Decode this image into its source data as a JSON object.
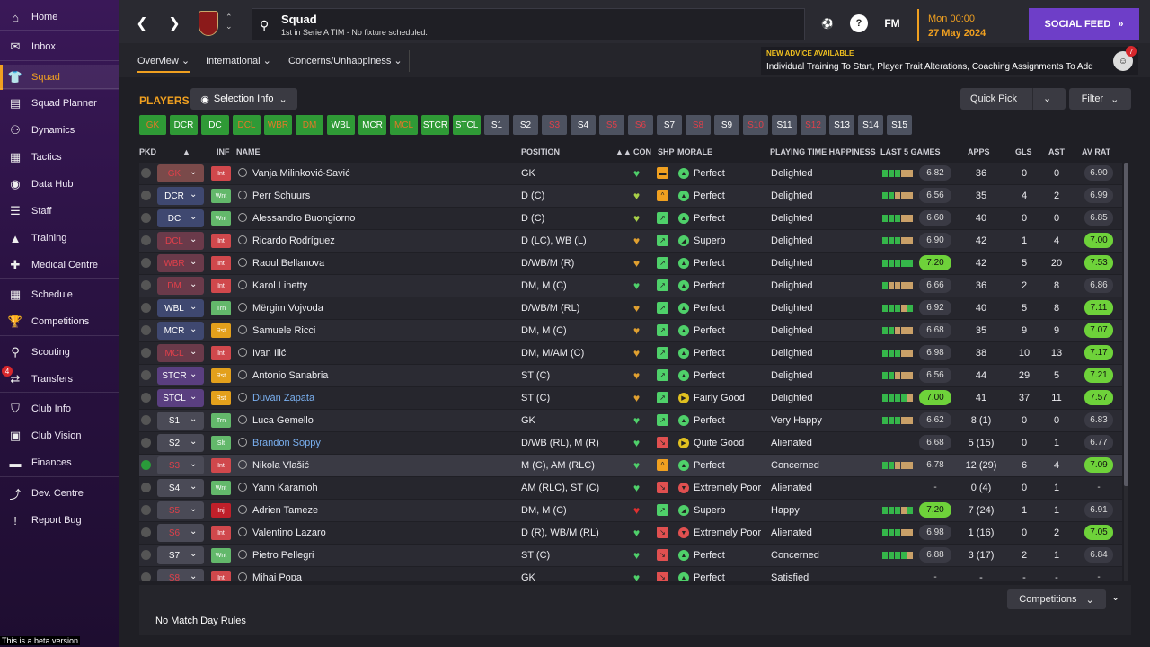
{
  "sidebar": {
    "items": [
      {
        "label": "Home",
        "icon": "⌂",
        "name": "home"
      },
      {
        "label": "Inbox",
        "icon": "✉",
        "name": "inbox"
      },
      {
        "label": "Squad",
        "icon": "👕",
        "name": "squad"
      },
      {
        "label": "Squad Planner",
        "icon": "▤",
        "name": "squad-planner"
      },
      {
        "label": "Dynamics",
        "icon": "⚇",
        "name": "dynamics"
      },
      {
        "label": "Tactics",
        "icon": "▦",
        "name": "tactics"
      },
      {
        "label": "Data Hub",
        "icon": "◉",
        "name": "data-hub"
      },
      {
        "label": "Staff",
        "icon": "☰",
        "name": "staff"
      },
      {
        "label": "Training",
        "icon": "▲",
        "name": "training"
      },
      {
        "label": "Medical Centre",
        "icon": "✚",
        "name": "medical-centre"
      },
      {
        "label": "Schedule",
        "icon": "▦",
        "name": "schedule"
      },
      {
        "label": "Competitions",
        "icon": "🏆",
        "name": "competitions"
      },
      {
        "label": "Scouting",
        "icon": "⚲",
        "name": "scouting"
      },
      {
        "label": "Transfers",
        "icon": "⇄",
        "name": "transfers"
      },
      {
        "label": "Club Info",
        "icon": "⛉",
        "name": "club-info"
      },
      {
        "label": "Club Vision",
        "icon": "▣",
        "name": "club-vision"
      },
      {
        "label": "Finances",
        "icon": "▬",
        "name": "finances"
      },
      {
        "label": "Dev. Centre",
        "icon": "⤴",
        "name": "dev-centre"
      },
      {
        "label": "Report Bug",
        "icon": "!",
        "name": "report-bug"
      }
    ],
    "transfers_badge": "4",
    "beta_notice": "This is a beta version"
  },
  "topbar": {
    "title": "Squad",
    "subtitle": "1st in Serie A TIM - No fixture scheduled.",
    "fm_label": "FM",
    "help_label": "?",
    "date_line1": "Mon 00:00",
    "date_line2": "27 May 2024",
    "social_feed": "SOCIAL FEED"
  },
  "subtabs": {
    "overview": "Overview",
    "international": "International",
    "concerns": "Concerns/Unhappiness"
  },
  "advice": {
    "heading": "NEW ADVICE AVAILABLE",
    "text": "Individual Training To Start, Player Trait Alterations, Coaching Assignments To Add",
    "count": "7"
  },
  "main": {
    "players_title": "PLAYERS",
    "selection_info": "Selection Info",
    "quick_pick": "Quick Pick",
    "filter": "Filter"
  },
  "slots": [
    {
      "label": "GK",
      "style": "gr"
    },
    {
      "label": "DCR",
      "style": "g"
    },
    {
      "label": "DC",
      "style": "g"
    },
    {
      "label": "DCL",
      "style": "gr"
    },
    {
      "label": "WBR",
      "style": "gr"
    },
    {
      "label": "DM",
      "style": "gr"
    },
    {
      "label": "WBL",
      "style": "g"
    },
    {
      "label": "MCR",
      "style": "g"
    },
    {
      "label": "MCL",
      "style": "gr"
    },
    {
      "label": "STCR",
      "style": "g"
    },
    {
      "label": "STCL",
      "style": "g"
    },
    {
      "label": "S1",
      "style": "s"
    },
    {
      "label": "S2",
      "style": "s"
    },
    {
      "label": "S3",
      "style": "sr"
    },
    {
      "label": "S4",
      "style": "s"
    },
    {
      "label": "S5",
      "style": "sr"
    },
    {
      "label": "S6",
      "style": "sr"
    },
    {
      "label": "S7",
      "style": "s"
    },
    {
      "label": "S8",
      "style": "sr"
    },
    {
      "label": "S9",
      "style": "s"
    },
    {
      "label": "S10",
      "style": "sr"
    },
    {
      "label": "S11",
      "style": "s"
    },
    {
      "label": "S12",
      "style": "sr"
    },
    {
      "label": "S13",
      "style": "s"
    },
    {
      "label": "S14",
      "style": "s"
    },
    {
      "label": "S15",
      "style": "s"
    }
  ],
  "columns": {
    "pkd": "PKD",
    "inf": "INF",
    "name": "NAME",
    "position": "POSITION",
    "con": "CON",
    "shp": "SHP",
    "morale": "MORALE",
    "pth": "PLAYING TIME HAPPINESS",
    "last5": "LAST 5 GAMES",
    "apps": "APPS",
    "gls": "GLS",
    "ast": "AST",
    "avrat": "AV RAT"
  },
  "colors": {
    "accent": "#f0a020",
    "social": "#6e3ec8",
    "good": "#6ed23a"
  },
  "players": [
    {
      "slot": "GK",
      "slot_red": true,
      "inf": "Int",
      "name": "Vanja Milinković-Savić",
      "pos": "GK",
      "con": "#4fd06a",
      "shp": "#f0a020",
      "shp_sym": "▬",
      "mor_c": "#4fd06a",
      "mor_sym": "▲",
      "morale": "Perfect",
      "pth": "Delighted",
      "bars": "gggbb",
      "form": "6.82",
      "form_good": false,
      "apps": "36",
      "gls": "0",
      "ast": "0",
      "avr": "6.90",
      "avr_good": false
    },
    {
      "slot": "DCR",
      "slot_red": false,
      "inf": "Wnt",
      "name": "Perr Schuurs",
      "pos": "D (C)",
      "con": "#a8d048",
      "shp": "#f0a020",
      "shp_sym": "^",
      "mor_c": "#4fd06a",
      "mor_sym": "▲",
      "morale": "Perfect",
      "pth": "Delighted",
      "bars": "ggbbb",
      "form": "6.56",
      "form_good": false,
      "apps": "35",
      "gls": "4",
      "ast": "2",
      "avr": "6.99",
      "avr_good": false
    },
    {
      "slot": "DC",
      "slot_red": false,
      "inf": "Wnt",
      "name": "Alessandro Buongiorno",
      "pos": "D (C)",
      "con": "#a8d048",
      "shp": "#4fd06a",
      "shp_sym": "↗",
      "mor_c": "#4fd06a",
      "mor_sym": "▲",
      "morale": "Perfect",
      "pth": "Delighted",
      "bars": "gggbb",
      "form": "6.60",
      "form_good": false,
      "apps": "40",
      "gls": "0",
      "ast": "0",
      "avr": "6.85",
      "avr_good": false
    },
    {
      "slot": "DCL",
      "slot_red": true,
      "inf": "Int",
      "name": "Ricardo Rodríguez",
      "pos": "D (LC), WB (L)",
      "con": "#e0a030",
      "shp": "#4fd06a",
      "shp_sym": "↗",
      "mor_c": "#4fd06a",
      "mor_sym": "◢",
      "morale": "Superb",
      "pth": "Delighted",
      "bars": "gggbb",
      "form": "6.90",
      "form_good": false,
      "apps": "42",
      "gls": "1",
      "ast": "4",
      "avr": "7.00",
      "avr_good": true
    },
    {
      "slot": "WBR",
      "slot_red": true,
      "inf": "Int",
      "name": "Raoul Bellanova",
      "pos": "D/WB/M (R)",
      "con": "#e0a030",
      "shp": "#4fd06a",
      "shp_sym": "↗",
      "mor_c": "#4fd06a",
      "mor_sym": "▲",
      "morale": "Perfect",
      "pth": "Delighted",
      "bars": "ggggg",
      "form": "7.20",
      "form_good": true,
      "apps": "42",
      "gls": "5",
      "ast": "20",
      "avr": "7.53",
      "avr_good": true
    },
    {
      "slot": "DM",
      "slot_red": true,
      "inf": "Int",
      "name": "Karol Linetty",
      "pos": "DM, M (C)",
      "con": "#4fd06a",
      "shp": "#4fd06a",
      "shp_sym": "↗",
      "mor_c": "#4fd06a",
      "mor_sym": "▲",
      "morale": "Perfect",
      "pth": "Delighted",
      "bars": "gbbbb",
      "form": "6.66",
      "form_good": false,
      "apps": "36",
      "gls": "2",
      "ast": "8",
      "avr": "6.86",
      "avr_good": false
    },
    {
      "slot": "WBL",
      "slot_red": false,
      "inf": "Trn",
      "name": "Mërgim Vojvoda",
      "pos": "D/WB/M (RL)",
      "con": "#e0a030",
      "shp": "#4fd06a",
      "shp_sym": "↗",
      "mor_c": "#4fd06a",
      "mor_sym": "▲",
      "morale": "Perfect",
      "pth": "Delighted",
      "bars": "gggbg",
      "form": "6.92",
      "form_good": false,
      "apps": "40",
      "gls": "5",
      "ast": "8",
      "avr": "7.11",
      "avr_good": true
    },
    {
      "slot": "MCR",
      "slot_red": false,
      "inf": "Rst",
      "name": "Samuele Ricci",
      "pos": "DM, M (C)",
      "con": "#e0a030",
      "shp": "#4fd06a",
      "shp_sym": "↗",
      "mor_c": "#4fd06a",
      "mor_sym": "▲",
      "morale": "Perfect",
      "pth": "Delighted",
      "bars": "ggbbb",
      "form": "6.68",
      "form_good": false,
      "apps": "35",
      "gls": "9",
      "ast": "9",
      "avr": "7.07",
      "avr_good": true
    },
    {
      "slot": "MCL",
      "slot_red": true,
      "inf": "Int",
      "name": "Ivan Ilić",
      "pos": "DM, M/AM (C)",
      "con": "#e0a030",
      "shp": "#4fd06a",
      "shp_sym": "↗",
      "mor_c": "#4fd06a",
      "mor_sym": "▲",
      "morale": "Perfect",
      "pth": "Delighted",
      "bars": "gggbb",
      "form": "6.98",
      "form_good": false,
      "apps": "38",
      "gls": "10",
      "ast": "13",
      "avr": "7.17",
      "avr_good": true
    },
    {
      "slot": "STCR",
      "slot_red": false,
      "inf": "Rst",
      "name": "Antonio Sanabria",
      "pos": "ST (C)",
      "con": "#e0a030",
      "shp": "#4fd06a",
      "shp_sym": "↗",
      "mor_c": "#4fd06a",
      "mor_sym": "▲",
      "morale": "Perfect",
      "pth": "Delighted",
      "bars": "ggbbb",
      "form": "6.56",
      "form_good": false,
      "apps": "44",
      "gls": "29",
      "ast": "5",
      "avr": "7.21",
      "avr_good": true
    },
    {
      "slot": "STCL",
      "slot_red": false,
      "inf": "Rst",
      "name": "Duván Zapata",
      "name_blue": true,
      "pos": "ST (C)",
      "con": "#e0a030",
      "shp": "#4fd06a",
      "shp_sym": "↗",
      "mor_c": "#e0c020",
      "mor_sym": "▶",
      "morale": "Fairly Good",
      "pth": "Delighted",
      "bars": "ggggb",
      "form": "7.00",
      "form_good": true,
      "apps": "41",
      "gls": "37",
      "ast": "11",
      "avr": "7.57",
      "avr_good": true
    },
    {
      "slot": "S1",
      "slot_red": false,
      "inf": "Trn",
      "name": "Luca Gemello",
      "pos": "GK",
      "con": "#4fd06a",
      "shp": "#4fd06a",
      "shp_sym": "↗",
      "mor_c": "#4fd06a",
      "mor_sym": "▲",
      "morale": "Perfect",
      "pth": "Very Happy",
      "bars": "gggbb",
      "form": "6.62",
      "form_good": false,
      "apps": "8 (1)",
      "gls": "0",
      "ast": "0",
      "avr": "6.83",
      "avr_good": false
    },
    {
      "slot": "S2",
      "slot_red": false,
      "inf": "Slt",
      "name": "Brandon Soppy",
      "name_blue": true,
      "pos": "D/WB (RL), M (R)",
      "con": "#4fd06a",
      "shp": "#e05050",
      "shp_sym": "↘",
      "mor_c": "#e0c020",
      "mor_sym": "▶",
      "morale": "Quite Good",
      "pth": "Alienated",
      "bars": "",
      "form": "6.68",
      "form_good": false,
      "apps": "5 (15)",
      "gls": "0",
      "ast": "1",
      "avr": "6.77",
      "avr_good": false
    },
    {
      "slot": "S3",
      "slot_red": true,
      "inf": "Int",
      "name": "Nikola Vlašić",
      "pos": "M (C), AM (RLC)",
      "con": "#4fd06a",
      "shp": "#f0a020",
      "shp_sym": "^",
      "mor_c": "#4fd06a",
      "mor_sym": "▲",
      "morale": "Perfect",
      "pth": "Concerned",
      "bars": "ggbbb",
      "form": "6.78",
      "form_good": false,
      "apps": "12 (29)",
      "gls": "6",
      "ast": "4",
      "avr": "7.09",
      "avr_good": true,
      "highlight": true,
      "picked": true
    },
    {
      "slot": "S4",
      "slot_red": false,
      "inf": "Wnt",
      "name": "Yann Karamoh",
      "pos": "AM (RLC), ST (C)",
      "con": "#4fd06a",
      "shp": "#e05050",
      "shp_sym": "↘",
      "mor_c": "#e05050",
      "mor_sym": "▼",
      "morale": "Extremely Poor",
      "pth": "Alienated",
      "bars": "",
      "form": "-",
      "form_good": false,
      "form_empty": true,
      "apps": "0 (4)",
      "gls": "0",
      "ast": "1",
      "avr": "-",
      "avr_good": false,
      "avr_empty": true
    },
    {
      "slot": "S5",
      "slot_red": true,
      "inf": "Inj",
      "name": "Adrien Tameze",
      "pos": "DM, M (C)",
      "con": "#e03030",
      "shp": "#4fd06a",
      "shp_sym": "↗",
      "mor_c": "#4fd06a",
      "mor_sym": "◢",
      "morale": "Superb",
      "pth": "Happy",
      "bars": "gggbg",
      "form": "7.20",
      "form_good": true,
      "apps": "7 (24)",
      "gls": "1",
      "ast": "1",
      "avr": "6.91",
      "avr_good": false
    },
    {
      "slot": "S6",
      "slot_red": true,
      "inf": "Int",
      "name": "Valentino Lazaro",
      "pos": "D (R), WB/M (RL)",
      "con": "#4fd06a",
      "shp": "#e05050",
      "shp_sym": "↘",
      "mor_c": "#e05050",
      "mor_sym": "▼",
      "morale": "Extremely Poor",
      "pth": "Alienated",
      "bars": "gggbb",
      "form": "6.98",
      "form_good": false,
      "apps": "1 (16)",
      "gls": "0",
      "ast": "2",
      "avr": "7.05",
      "avr_good": true
    },
    {
      "slot": "S7",
      "slot_red": false,
      "inf": "Wnt",
      "name": "Pietro Pellegri",
      "pos": "ST (C)",
      "con": "#4fd06a",
      "shp": "#e05050",
      "shp_sym": "↘",
      "mor_c": "#4fd06a",
      "mor_sym": "▲",
      "morale": "Perfect",
      "pth": "Concerned",
      "bars": "ggggb",
      "form": "6.88",
      "form_good": false,
      "apps": "3 (17)",
      "gls": "2",
      "ast": "1",
      "avr": "6.84",
      "avr_good": false
    },
    {
      "slot": "S8",
      "slot_red": true,
      "inf": "Int",
      "name": "Mihai Popa",
      "pos": "GK",
      "con": "#4fd06a",
      "shp": "#e05050",
      "shp_sym": "↘",
      "mor_c": "#4fd06a",
      "mor_sym": "▲",
      "morale": "Perfect",
      "pth": "Satisfied",
      "bars": "",
      "form": "-",
      "form_good": false,
      "form_empty": true,
      "apps": "-",
      "gls": "-",
      "ast": "-",
      "avr": "-",
      "avr_good": false,
      "avr_empty": true
    }
  ],
  "bottom": {
    "competitions": "Competitions",
    "no_match": "No Match Day Rules"
  }
}
